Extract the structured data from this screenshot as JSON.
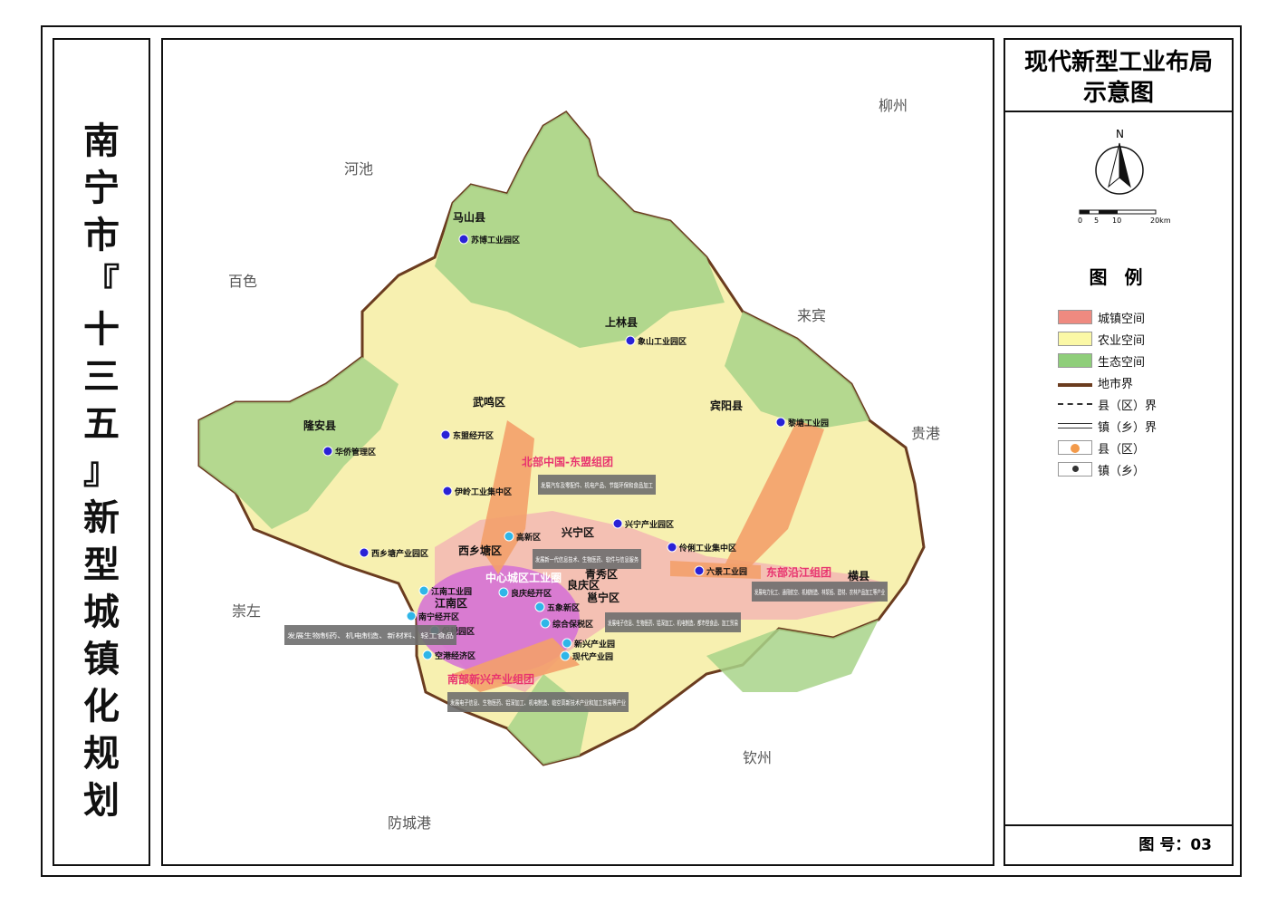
{
  "vertical_title": "南宁市『十三五』新型城镇化规划",
  "legend": {
    "title_line1": "现代新型工业布局",
    "title_line2": "示意图",
    "north": "N",
    "scale_ticks": [
      "0",
      "5",
      "10",
      "20km"
    ],
    "heading": "图 例",
    "items": [
      {
        "label": "城镇空间",
        "color": "#ef8a80"
      },
      {
        "label": "农业空间",
        "color": "#fbf8a6"
      },
      {
        "label": "生态空间",
        "color": "#8fce7a"
      },
      {
        "label": "地市界"
      },
      {
        "label": "县（区）界"
      },
      {
        "label": "镇（乡）界"
      },
      {
        "label": "县（区）",
        "color": "#f39a4a"
      },
      {
        "label": "镇（乡）",
        "color": "#333333"
      }
    ],
    "figure_number": "图 号：03"
  },
  "map": {
    "neighbors": [
      "河池",
      "柳州",
      "百色",
      "来宾",
      "贵港",
      "崇左",
      "钦州",
      "防城港"
    ],
    "counties": [
      "马山县",
      "上林县",
      "武鸣区",
      "宾阳县",
      "隆安县",
      "兴宁区",
      "西乡塘区",
      "青秀区",
      "江南区",
      "邕宁区",
      "良庆区",
      "横县"
    ],
    "parks": [
      "苏博工业园区",
      "象山工业园区",
      "东盟经开区",
      "华侨管理区",
      "伊岭工业集中区",
      "兴宁产业园区",
      "西乡塘产业园区",
      "黎塘工业园",
      "伶俐工业集中区",
      "六景工业园",
      "高新区",
      "江南工业园",
      "良庆经开区",
      "五象新区",
      "南宁经开区",
      "综合保税区",
      "保税园区",
      "空港经济区",
      "新兴产业园",
      "现代产业园"
    ],
    "clusters": [
      "北部中国-东盟组团",
      "中心城区工业圈",
      "东部沿江组团",
      "南部新兴产业组团"
    ],
    "notes": [
      "发展汽车及零配件、机电产品、节能环保和食品加工",
      "发展新一代信息技术、生物医药、软件与信息服务",
      "发展电力化工、通用航空、机械制造、林浆纸、建材、农林产品加工等产业",
      "发展电子信息、生物医药、铝深加工、机电制造、都市型食品、加工贸易",
      "发展生物制药、机电制造、新材料、轻工食品",
      "发展电子信息、生物医药、铝深加工、机电制造、临空高新技术产业和加工贸易等产业"
    ]
  }
}
